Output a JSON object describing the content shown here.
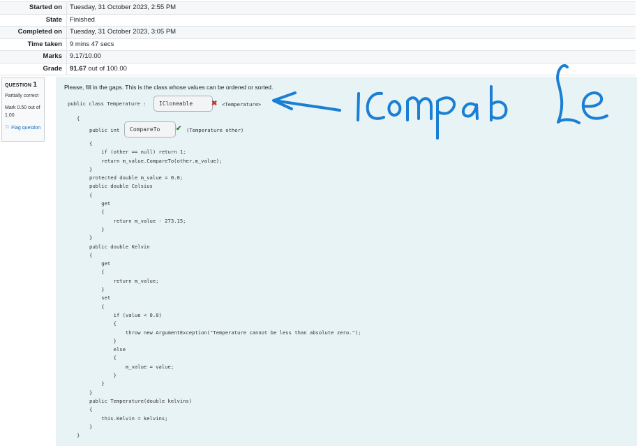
{
  "summary": [
    {
      "label": "Started on",
      "value": "Tuesday, 31 October 2023, 2:55 PM"
    },
    {
      "label": "State",
      "value": "Finished"
    },
    {
      "label": "Completed on",
      "value": "Tuesday, 31 October 2023, 3:05 PM"
    },
    {
      "label": "Time taken",
      "value": "9 mins 47 secs"
    },
    {
      "label": "Marks",
      "value": "9.17/10.00"
    },
    {
      "label": "Grade",
      "value_bold": "91.67",
      "value_rest": " out of 100.00"
    }
  ],
  "question": {
    "title_prefix": "QUESTION",
    "number": "1",
    "state": "Partially correct",
    "mark": "Mark 0.50 out of 1.00",
    "flag_label": "Flag question",
    "prompt": "Please, fill in the gaps. This is the class whose values can be ordered or sorted."
  },
  "code": {
    "class_decl": "public class Temperature :",
    "class_generic": "<Temperature>",
    "open_brace": "{",
    "method_prefix": "public int",
    "method_suffix": "(Temperature other)",
    "body": "{\n    if (other == null) return 1;\n    return m_value.CompareTo(other.m_value);\n}\nprotected double m_value = 0.0;\npublic double Celsius\n{\n    get\n    {\n        return m_value - 273.15;\n    }\n}\npublic double Kelvin\n{\n    get\n    {\n        return m_value;\n    }\n    set\n    {\n        if (value < 0.0)\n        {\n            throw new ArgumentException(\"Temperature cannot be less than absolute zero.\");\n        }\n        else\n        {\n            m_value = value;\n        }\n    }\n}\npublic Temperature(double kelvins)\n{\n    this.Kelvin = kelvins;\n}",
    "close_brace": "}"
  },
  "gaps": {
    "gap1_value": "ICloneable",
    "gap2_value": "CompareTo"
  },
  "colors": {
    "incorrect": "#ca3120",
    "correct": "#357a32",
    "annotation": "#1a7fd4"
  }
}
